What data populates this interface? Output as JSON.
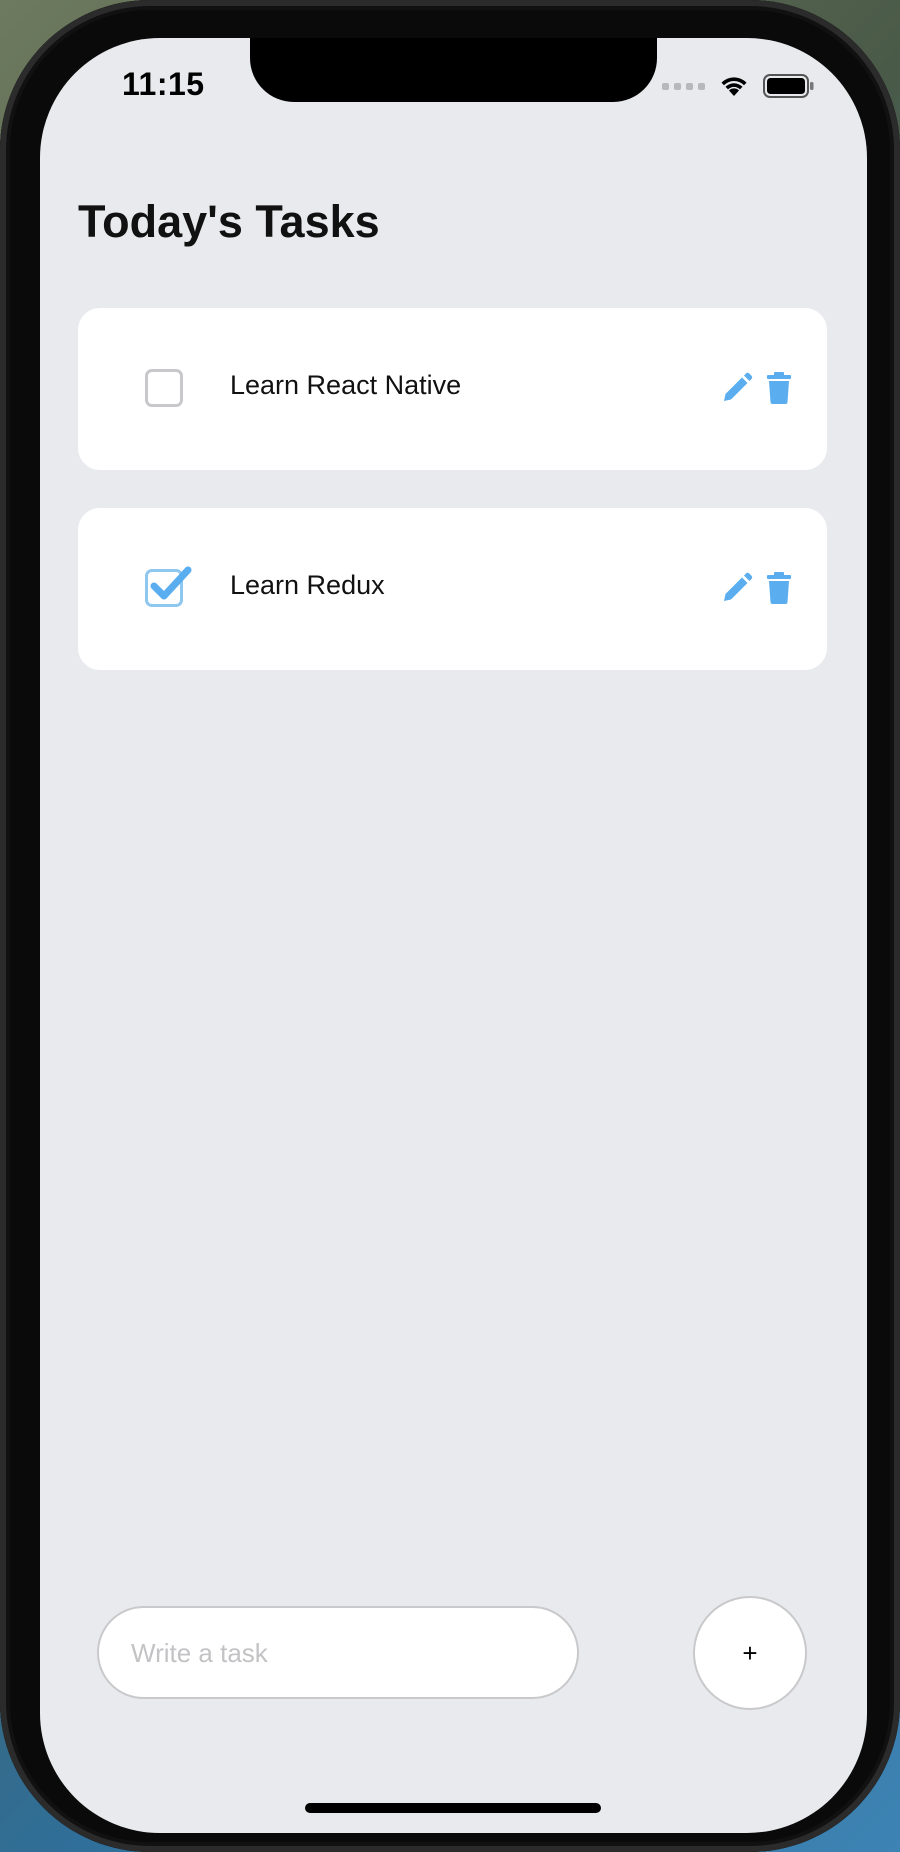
{
  "status_bar": {
    "time": "11:15"
  },
  "header": {
    "title": "Today's Tasks"
  },
  "tasks": [
    {
      "label": "Learn React Native",
      "completed": false,
      "edit_icon": "pencil-icon",
      "delete_icon": "trash-icon"
    },
    {
      "label": "Learn Redux",
      "completed": true,
      "edit_icon": "pencil-icon",
      "delete_icon": "trash-icon"
    }
  ],
  "composer": {
    "input_placeholder": "Write a task",
    "input_value": "",
    "add_button_label": "+"
  },
  "colors": {
    "accent": "#5aaef0",
    "checked_border": "#8ec7f0",
    "background": "#e8eaed",
    "card": "#ffffff"
  }
}
